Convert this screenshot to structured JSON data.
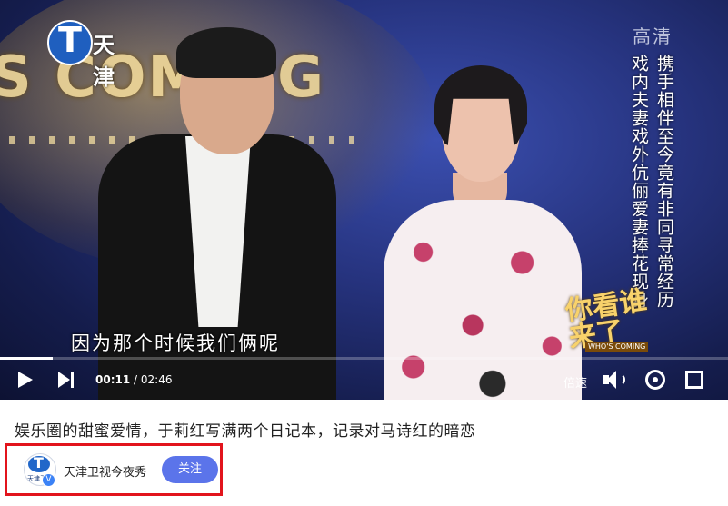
{
  "video": {
    "channel_logo_text": "天津",
    "logo_glyph": "T",
    "hd_label": "高清",
    "backdrop_text": "S COMING",
    "headline_col1": "携手相伴至今竟有非同寻常经历",
    "headline_col2": "戏内夫妻戏外伉俪爱妻捧花现身",
    "subtitle": "因为那个时候我们俩呢",
    "show_badge": {
      "title": "你看谁来了",
      "sub": "WHO'S COMING"
    },
    "progress_fraction": 0.073
  },
  "controls": {
    "current_time": "00:11",
    "separator": " / ",
    "duration": "02:46",
    "speed_label": "倍速",
    "icons": [
      "play-icon",
      "next-icon",
      "volume-icon",
      "settings-icon",
      "fullscreen-icon"
    ]
  },
  "post": {
    "title": "娱乐圈的甜蜜爱情，于莉红写满两个日记本，记录对马诗红的暗恋"
  },
  "author": {
    "avatar_caption": "天津卫视",
    "avatar_glyph": "T",
    "verified_mark": "V",
    "name": "天津卫视今夜秀",
    "follow_label": "关注"
  },
  "colors": {
    "highlight_border": "#e2141c",
    "follow_button": "#5b74ea",
    "brand_blue": "#1f5fbf"
  }
}
